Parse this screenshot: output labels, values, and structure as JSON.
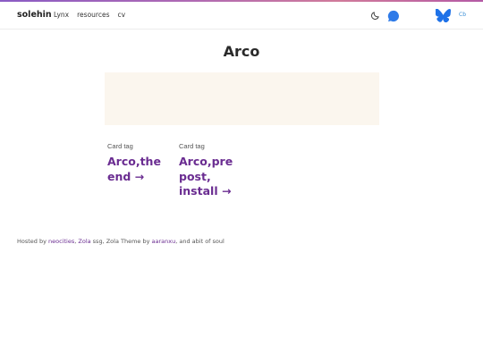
{
  "header": {
    "brand": "solehin",
    "nav": [
      "Lynx",
      "resources",
      "cv"
    ],
    "lang_label": "Cb",
    "icons": [
      "moon-icon",
      "chat-bubble-icon",
      "butterfly-icon"
    ],
    "accent_color": "#6a2c91",
    "link_color": "#3b8fd6"
  },
  "main": {
    "title": "Arco",
    "cards": [
      {
        "tag": "Card tag",
        "title_lines": [
          "Arco,the",
          "end →"
        ]
      },
      {
        "tag": "Card tag",
        "title_lines": [
          "Arco,pre",
          "post,",
          "install →"
        ]
      }
    ]
  },
  "footer": {
    "prefix": "Hosted by ",
    "host": "neocities",
    "sep": ", ",
    "ssg": "Zola",
    "mid": " ssg, Zola Theme by ",
    "author": "aaranxu",
    "suffix": ", and abit of soul"
  }
}
